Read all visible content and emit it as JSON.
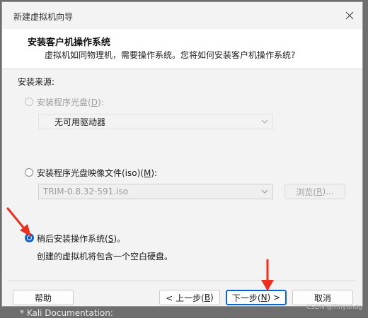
{
  "window": {
    "title": "新建虚拟机向导"
  },
  "header": {
    "title": "安装客户机操作系统",
    "subtitle": "虚拟机如同物理机，需要操作系统。您将如何安装客户机操作系统?"
  },
  "source_label": "安装来源:",
  "options": {
    "disc": {
      "label_pre": "安装程序光盘(",
      "key": "D",
      "label_post": "):",
      "selected": false,
      "enabled": false,
      "drive_value": "无可用驱动器"
    },
    "iso": {
      "label_pre": "安装程序光盘映像文件(iso)(",
      "key": "M",
      "label_post": "):",
      "selected": false,
      "enabled": true,
      "path_value": "TRIM-0.8.32-591.iso",
      "browse_pre": "浏览(",
      "browse_key": "R",
      "browse_post": ")..."
    },
    "later": {
      "label_pre": "稍后安装操作系统(",
      "key": "S",
      "label_post": ")。",
      "selected": true,
      "description": "创建的虚拟机将包含一个空白硬盘。"
    }
  },
  "buttons": {
    "help": "帮助",
    "back_pre": "< 上一步(",
    "back_key": "B",
    "back_post": ")",
    "next_pre": "下一步(",
    "next_key": "N",
    "next_post": ") >",
    "cancel": "取消"
  },
  "background_text": "* Kali Documentation:",
  "watermark": "CSDN @Tinyundg",
  "colors": {
    "accent": "#0f62c9",
    "annotation": "#e8311f"
  },
  "icons": {
    "close": "close-icon",
    "dropdown": "chevron-down-icon",
    "annotation": "red-arrow-icon"
  }
}
